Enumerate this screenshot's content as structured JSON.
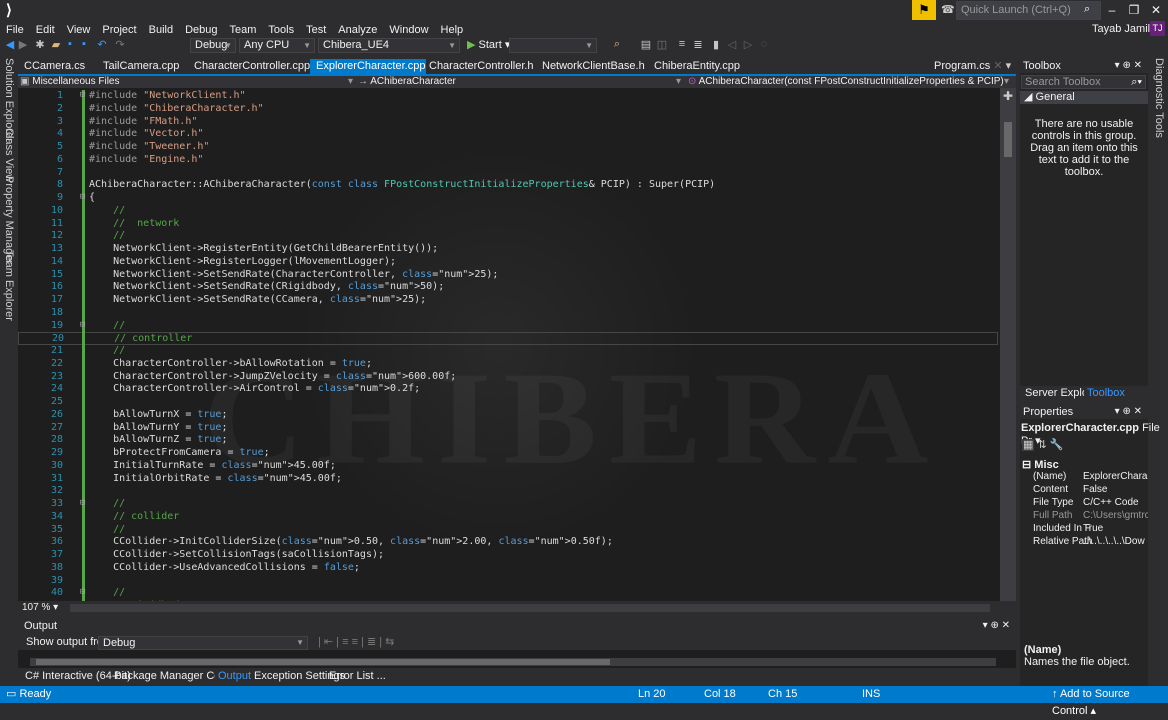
{
  "menu": [
    "File",
    "Edit",
    "View",
    "Project",
    "Build",
    "Debug",
    "Team",
    "Tools",
    "Test",
    "Analyze",
    "Window",
    "Help"
  ],
  "title": {
    "quick_launch_placeholder": "Quick Launch (Ctrl+Q)",
    "user": "Tayab Jamil",
    "avatar_initials": "TJ"
  },
  "toolbar": {
    "config": "Debug",
    "platform": "Any CPU",
    "project": "Chibera_UE4",
    "start_label": "Start"
  },
  "doc_tabs": [
    {
      "label": "CCamera.cs",
      "active": false
    },
    {
      "label": "TailCamera.cpp",
      "active": false
    },
    {
      "label": "CharacterController.cpp",
      "active": false
    },
    {
      "label": "ExplorerCharacter.cpp",
      "active": true
    },
    {
      "label": "CharacterController.h",
      "active": false
    },
    {
      "label": "NetworkClientBase.h",
      "active": false
    },
    {
      "label": "ChiberaEntity.cpp",
      "active": false
    },
    {
      "label": "Program.cs",
      "active": false
    }
  ],
  "navbar": {
    "scope": "Miscellaneous Files",
    "class": "AChiberaCharacter",
    "member": "AChiberaCharacter(const FPostConstructInitializeProperties & PCIP)"
  },
  "code_lines": [
    "#include \"NetworkClient.h\"",
    "#include \"ChiberaCharacter.h\"",
    "#include \"FMath.h\"",
    "#include \"Vector.h\"",
    "#include \"Tweener.h\"",
    "#include \"Engine.h\"",
    "",
    "AChiberaCharacter::AChiberaCharacter(const class FPostConstructInitializeProperties& PCIP) : Super(PCIP)",
    "{",
    "    //",
    "    //  network",
    "    //",
    "    NetworkClient->RegisterEntity(GetChildBearerEntity());",
    "    NetworkClient->RegisterLogger(lMovementLogger);",
    "    NetworkClient->SetSendRate(CharacterController, 25);",
    "    NetworkClient->SetSendRate(CRigidbody, 50);",
    "    NetworkClient->SetSendRate(CCamera, 25);",
    "",
    "    //",
    "    // controller",
    "    //",
    "    CharacterController->bAllowRotation = true;",
    "    CharacterController->JumpZVelocity = 600.00f;",
    "    CharacterController->AirControl = 0.2f;",
    "",
    "    bAllowTurnX = true;",
    "    bAllowTurnY = true;",
    "    bAllowTurnZ = true;",
    "    bProtectFromCamera = true;",
    "    InitialTurnRate = 45.00f;",
    "    InitialOrbitRate = 45.00f;",
    "",
    "    //",
    "    // collider",
    "    //",
    "    CCollider->InitColliderSize(0.50, 2.00, 0.50f);",
    "    CCollider->SetCollisionTags(saCollisionTags);",
    "    CCollider->UseAdvancedCollisions = false;",
    "",
    "    //",
    "    // rigidbody"
  ],
  "current_line": 20,
  "watermark": "CHIBERA",
  "zoom": "107 %",
  "output": {
    "title": "Output",
    "show_from_label": "Show output from:",
    "source": "Debug"
  },
  "bottom_tabs": [
    {
      "label": "C# Interactive (64-bit)",
      "active": false
    },
    {
      "label": "Package Manager Console",
      "active": false
    },
    {
      "label": "Output",
      "active": true
    },
    {
      "label": "Exception Settings",
      "active": false
    },
    {
      "label": "Error List ...",
      "active": false
    }
  ],
  "left_tabs": [
    "Solution Explorer",
    "Class View",
    "Property Manager",
    "Team Explorer"
  ],
  "right_tabs": [
    "Diagnostic Tools"
  ],
  "toolbox": {
    "title": "Toolbox",
    "search_placeholder": "Search Toolbox",
    "group": "General",
    "empty_message": "There are no usable controls in this group. Drag an item onto this text to add it to the toolbox."
  },
  "side_tabs": {
    "server_explorer": "Server Explorer",
    "toolbox": "Toolbox"
  },
  "properties": {
    "title": "Properties",
    "object": "ExplorerCharacter.cpp",
    "object_type": "File Pr",
    "category": "Misc",
    "rows": [
      {
        "name": "(Name)",
        "value": "ExplorerCharacte"
      },
      {
        "name": "Content",
        "value": "False"
      },
      {
        "name": "File Type",
        "value": "C/C++ Code"
      },
      {
        "name": "Full Path",
        "value": "C:\\Users\\gmtrc\\"
      },
      {
        "name": "Included In F",
        "value": "True"
      },
      {
        "name": "Relative Path",
        "value": "..\\..\\..\\..\\..\\Dow"
      }
    ],
    "desc_title": "(Name)",
    "desc_text": "Names the file object."
  },
  "status": {
    "ready": "Ready",
    "ln": "Ln 20",
    "col": "Col 18",
    "ch": "Ch 15",
    "mode": "INS",
    "source_control": "Add to Source Control"
  },
  "colors": {
    "accent": "#007acc",
    "editor_bg": "#1e1e1e",
    "chrome_bg": "#2d2d30"
  }
}
